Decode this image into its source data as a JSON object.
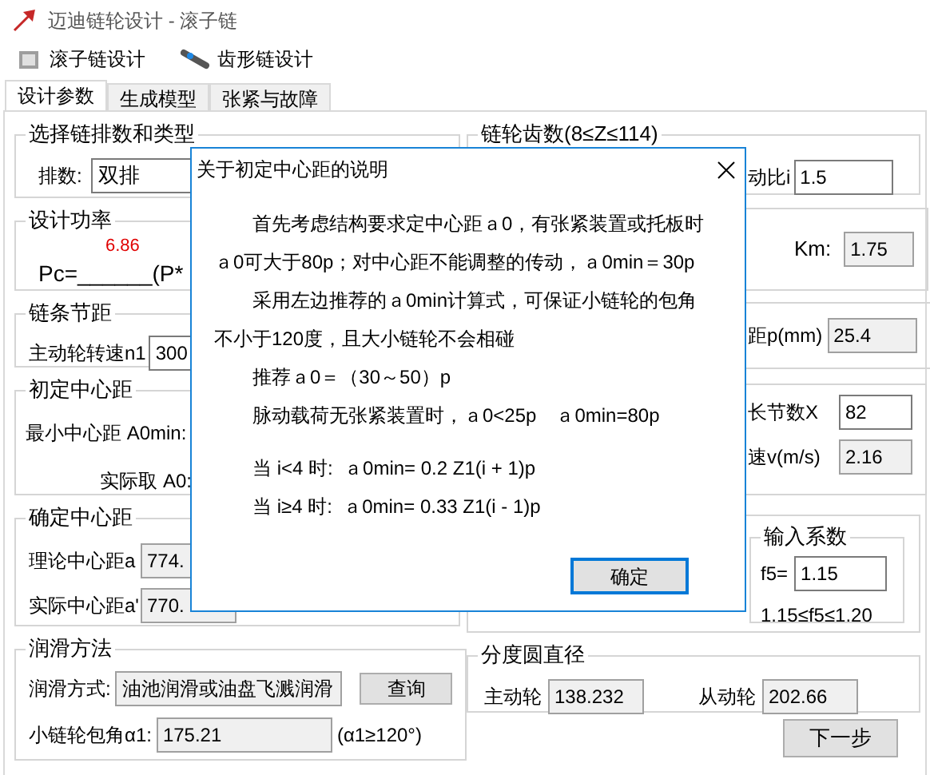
{
  "window": {
    "title": "迈迪链轮设计 - 滚子链"
  },
  "toolbar": [
    {
      "label": "滚子链设计"
    },
    {
      "label": "齿形链设计"
    }
  ],
  "tabs": [
    {
      "label": "设计参数",
      "selected": true
    },
    {
      "label": "生成模型",
      "selected": false
    },
    {
      "label": "张紧与故障",
      "selected": false
    }
  ],
  "chain_rows": {
    "title": "选择链排数和类型",
    "label": "排数:",
    "value": "双排"
  },
  "design_power": {
    "title": "设计功率",
    "result": "6.86",
    "formula": "Pc=______(P*"
  },
  "pitch": {
    "title": "链条节距",
    "label": "主动轮转速n1",
    "value": "300",
    "readonly": false
  },
  "initial_distance": {
    "title": "初定中心距",
    "min_label": "最小中心距 A0min:",
    "actual_label": "实际取 A0:"
  },
  "center_distance": {
    "title": "确定中心距",
    "rows": [
      {
        "label": "理论中心距a",
        "value": "774.",
        "readonly": true
      },
      {
        "label": "实际中心距a'",
        "value": "770.",
        "readonly": true
      }
    ]
  },
  "lubrication": {
    "title": "润滑方法",
    "method_label": "润滑方式:",
    "method": "油池润滑或油盘飞溅润滑",
    "query_button": "查询",
    "angle_label": "小链轮包角α1:",
    "angle": "175.21",
    "angle_note": "(α1≥120°)"
  },
  "teeth": {
    "title": "链轮齿数(8≤Z≤114)",
    "ratio_label": "动比i",
    "ratio": "1.5",
    "readonly": false
  },
  "coefficients": {
    "km_label": "Km:",
    "km": "1.75",
    "readonly": true
  },
  "chain_pitch": {
    "label": "距p(mm)",
    "value": "25.4",
    "readonly": true
  },
  "chain_length": {
    "rows": [
      {
        "label": "长节数X",
        "value": "82",
        "readonly": false
      },
      {
        "label": "速v(m/s)",
        "value": "2.16",
        "readonly": true
      }
    ]
  },
  "input_coefficient": {
    "title": "输入系数",
    "label": "f5=",
    "value": "1.15",
    "readonly": false,
    "range": "1.15≤f5≤1.20"
  },
  "pitch_diameter": {
    "title": "分度圆直径",
    "driver_label": "主动轮",
    "driver": "138.232",
    "driven_label": "从动轮",
    "driven": "202.66"
  },
  "next_button": "下一步",
  "dialog": {
    "title": "关于初定中心距的说明",
    "paragraphs": [
      [
        "首先考虑结构要求定中心距ａ0，有张紧装置或托板时",
        "ａ0可大于80p；对中心距不能调整的传动，ａ0min＝30p"
      ],
      [
        "采用左边推荐的ａ0min计算式，可保证小链轮的包角",
        "不小于120度，且大小链轮不会相碰"
      ],
      [
        "推荐ａ0＝（30～50）p"
      ],
      [
        "脉动载荷无张紧装置时，ａ0<25p　ａ0min=80p"
      ]
    ],
    "formulas": [
      "当 i<4 时:  ａ0min= 0.2 Z1(i + 1)p",
      "当 i≥4 时:  ａ0min= 0.33 Z1(i - 1)p"
    ],
    "ok_button": "确定"
  }
}
